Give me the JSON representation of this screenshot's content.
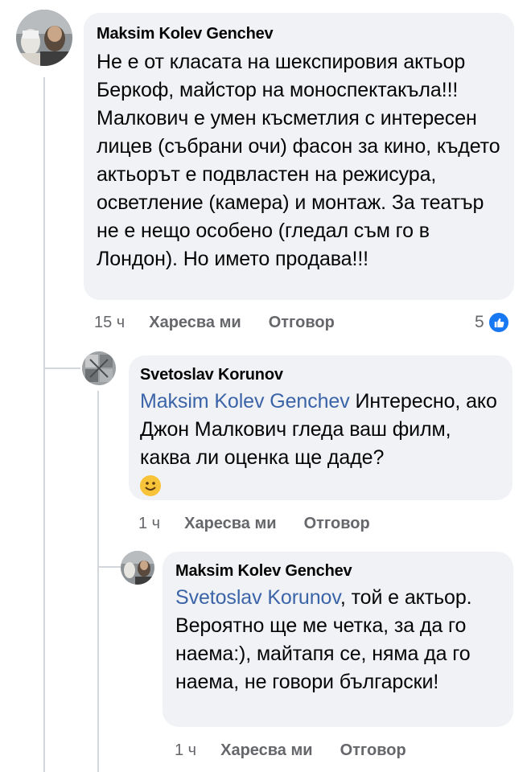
{
  "comments": [
    {
      "author": "Maksim Kolev Genchev",
      "text": "Не е от класата на шекспировия актьор Беркоф, майстор на моноспектакъла!!! Малкович е умен късметлия с интересен лицев (събрани очи) фасон за кино, където актьорът е подвластен на режисура, осветление (камера) и монтаж. За театър не е нещо особено (гледал съм го в Лондон). Но името продава!!!",
      "time": "15 ч",
      "like_label": "Харесва ми",
      "reply_label": "Отговор",
      "reaction_count": "5"
    },
    {
      "author": "Svetoslav Korunov",
      "mention": "Maksim Kolev Genchev",
      "text": "Интересно, ако Джон Малкович гледа ваш филм, каква ли оценка ще даде?",
      "emoji": "smiley",
      "time": "1 ч",
      "like_label": "Харесва ми",
      "reply_label": "Отговор"
    },
    {
      "author": "Maksim Kolev Genchev",
      "mention": "Svetoslav Korunov",
      "text": ", той е актьор. Вероятно ще ме четка, за да го наема:), майтапя се, няма да го наема, не говори български!",
      "time": "1 ч",
      "like_label": "Харесва ми",
      "reply_label": "Отговор"
    }
  ],
  "colors": {
    "bubble": "#f0f2f5",
    "mention": "#3b64a8",
    "meta": "#65676b",
    "like_badge": "#1877f2"
  }
}
